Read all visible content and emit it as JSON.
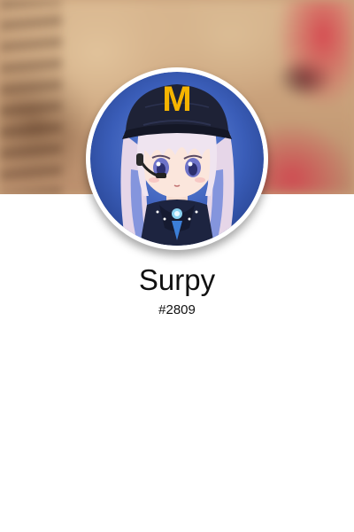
{
  "profile": {
    "display_name": "Surpy",
    "discriminator": "#2809",
    "avatar_icon": "anime-avatar-with-mcdonalds-cap-icon",
    "cap_logo_text": "M"
  },
  "colors": {
    "background": "#ffffff",
    "avatar_border": "#ffffff",
    "text": "#111111",
    "cap_logo": "#f5b400"
  }
}
